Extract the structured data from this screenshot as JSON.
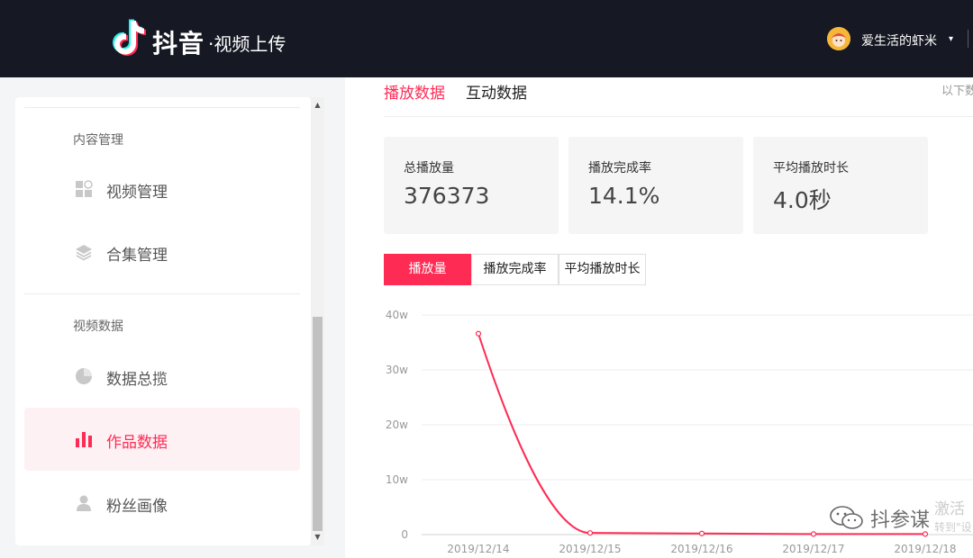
{
  "header": {
    "brand": "抖音",
    "brand_sub": "·视频上传",
    "username": "爱生活的虾米",
    "caret": "▾"
  },
  "sidebar": {
    "sections": [
      {
        "title": "内容管理"
      },
      {
        "title": "视频数据"
      }
    ],
    "items": [
      {
        "label": "视频管理",
        "icon": "grid-icon"
      },
      {
        "label": "合集管理",
        "icon": "layers-icon"
      },
      {
        "label": "数据总揽",
        "icon": "pie-chart-icon"
      },
      {
        "label": "作品数据",
        "icon": "bar-chart-icon",
        "active": true
      },
      {
        "label": "粉丝画像",
        "icon": "user-icon"
      }
    ]
  },
  "tabs": {
    "play": "播放数据",
    "interact": "互动数据",
    "hint": "以下数"
  },
  "stats": [
    {
      "label": "总播放量",
      "value": "376373"
    },
    {
      "label": "播放完成率",
      "value": "14.1%"
    },
    {
      "label": "平均播放时长",
      "value": "4.0秒"
    }
  ],
  "segments": {
    "plays": "播放量",
    "completion": "播放完成率",
    "avg_time": "平均播放时长"
  },
  "chart_data": {
    "type": "line",
    "x": [
      "2019/12/14",
      "2019/12/15",
      "2019/12/16",
      "2019/12/17",
      "2019/12/18"
    ],
    "series": [
      {
        "values": [
          36.6,
          0.3,
          0.2,
          0.1,
          0.1
        ]
      }
    ],
    "yticks": [
      "0",
      "10w",
      "20w",
      "30w",
      "40w"
    ],
    "ylim": [
      0,
      40
    ],
    "grid": true,
    "color": "#fe2c55"
  },
  "watermark": {
    "text": "抖参谋",
    "activate": "激活",
    "activate_sub": "转到\"设"
  },
  "colors": {
    "accent": "#fe2c55",
    "header_bg": "#161823"
  }
}
